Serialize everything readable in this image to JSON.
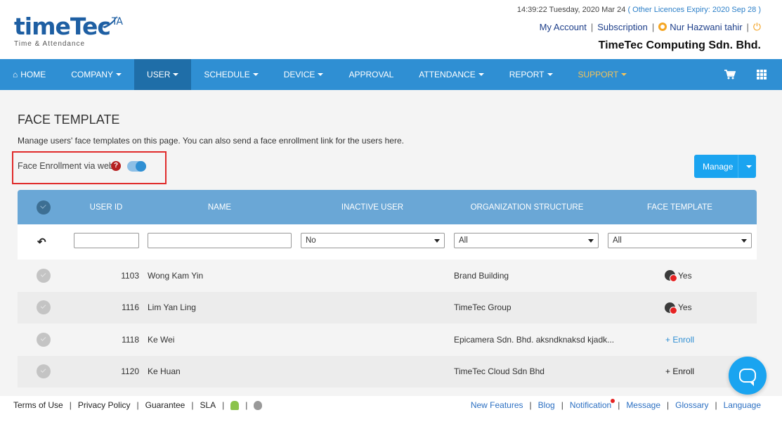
{
  "header": {
    "logo_text": "timeTec",
    "logo_ta": "TA",
    "logo_sub": "Time & Attendance",
    "datetime": "14:39:22 Tuesday, 2020 Mar 24",
    "licence_text": "( Other Licences Expiry:  2020 Sep 28 )",
    "links": {
      "my_account": "My Account",
      "subscription": "Subscription",
      "user_name": "Nur Hazwani tahir"
    },
    "separator": "|",
    "company": "TimeTec Computing Sdn. Bhd."
  },
  "nav": {
    "home": "HOME",
    "company": "COMPANY",
    "user": "USER",
    "schedule": "SCHEDULE",
    "device": "DEVICE",
    "approval": "APPROVAL",
    "attendance": "ATTENDANCE",
    "report": "REPORT",
    "support": "SUPPORT"
  },
  "page": {
    "title": "FACE TEMPLATE",
    "description": "Manage users' face templates on this page. You can also send a face enrollment link for the users here.",
    "enrollment_label": "Face Enrollment via web",
    "help": "?",
    "manage_button": "Manage"
  },
  "table": {
    "columns": {
      "user_id": "USER ID",
      "name": "NAME",
      "inactive": "INACTIVE USER",
      "org": "ORGANIZATION STRUCTURE",
      "face": "FACE TEMPLATE"
    },
    "filters": {
      "inactive": "No",
      "org": "All",
      "face": "All"
    },
    "rows": [
      {
        "id": "1103",
        "name": "Wong Kam Yin",
        "org": "Brand Building",
        "face": "Yes"
      },
      {
        "id": "1116",
        "name": "Lim Yan Ling",
        "org": "TimeTec Group",
        "face": "Yes"
      },
      {
        "id": "1118",
        "name": "Ke Wei",
        "org": "Epicamera Sdn. Bhd. aksndknaksd kjadk...",
        "face": "+ Enroll"
      },
      {
        "id": "1120",
        "name": "Ke Huan",
        "org": "TimeTec Cloud Sdn Bhd",
        "face": "+ Enroll"
      }
    ]
  },
  "footer": {
    "left": {
      "terms": "Terms of Use",
      "privacy": "Privacy Policy",
      "guarantee": "Guarantee",
      "sla": "SLA"
    },
    "right": {
      "new_features": "New Features",
      "blog": "Blog",
      "notification": "Notification",
      "message": "Message",
      "glossary": "Glossary",
      "language": "Language"
    }
  },
  "colors": {
    "nav_bg": "#2f8fd3",
    "nav_active": "#1f6ea8",
    "support": "#f4c45a",
    "manage_button": "#1aa4f0",
    "table_header": "#6aa7d6",
    "highlight_box": "#e02b2b"
  }
}
